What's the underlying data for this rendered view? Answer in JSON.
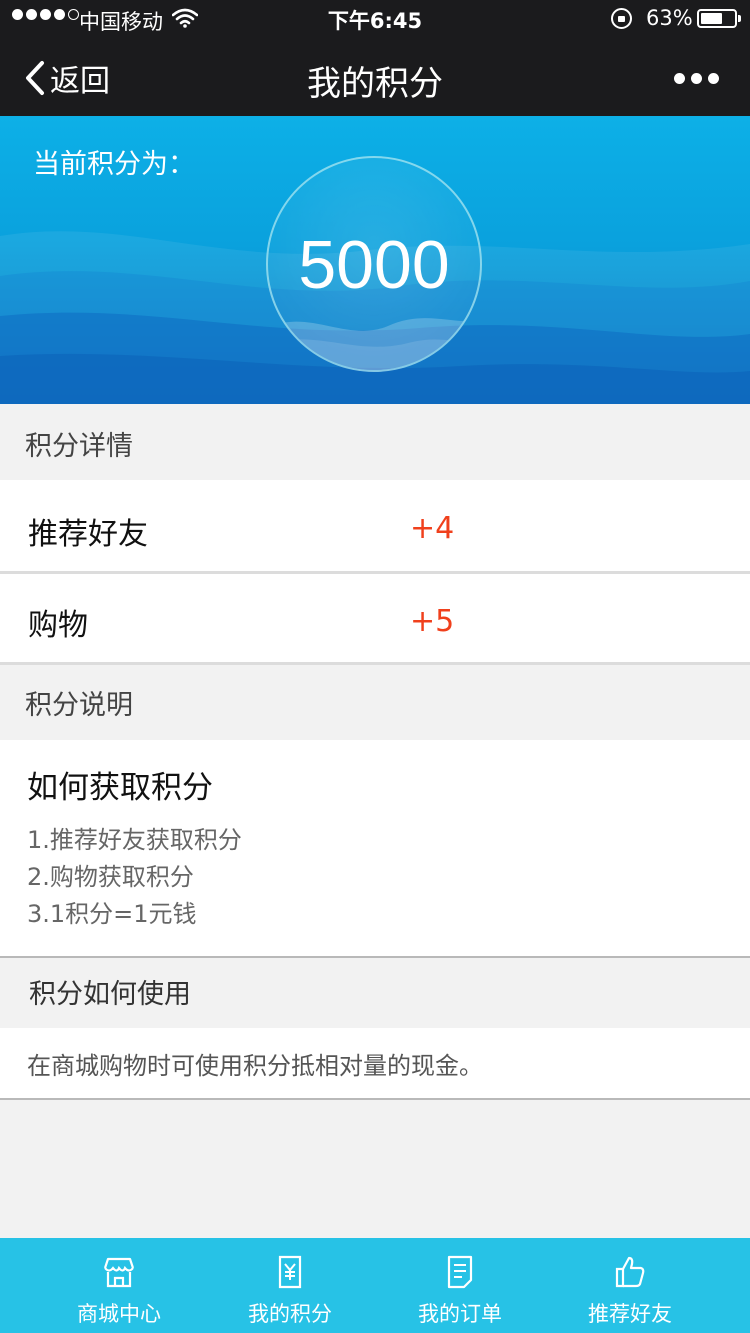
{
  "status_bar": {
    "carrier": "中国移动",
    "time": "下午6:45",
    "battery": "63%"
  },
  "nav": {
    "back_label": "返回",
    "title": "我的积分"
  },
  "hero": {
    "label": "当前积分为：",
    "points": "5000"
  },
  "details": {
    "heading": "积分详情",
    "items": [
      {
        "name": "推荐好友",
        "value": "+4"
      },
      {
        "name": "购物",
        "value": "+5"
      }
    ]
  },
  "explanation": {
    "heading": "积分说明",
    "title": "如何获取积分",
    "lines": [
      "1.推荐好友获取积分",
      "2.购物获取积分",
      "3.1积分=1元钱"
    ]
  },
  "usage": {
    "heading": "积分如何使用",
    "text": "在商城购物时可使用积分抵相对量的现金。"
  },
  "tabbar": {
    "tabs": [
      {
        "label": "商城中心",
        "icon": "shop-icon"
      },
      {
        "label": "我的积分",
        "icon": "points-receipt-icon"
      },
      {
        "label": "我的订单",
        "icon": "order-document-icon"
      },
      {
        "label": "推荐好友",
        "icon": "thumbs-up-icon"
      }
    ]
  },
  "colors": {
    "nav_bg": "#1b1b1d",
    "hero_blue": "#0aa1dd",
    "accent_red": "#f0401c",
    "tabbar_bg": "#27c2e6"
  }
}
